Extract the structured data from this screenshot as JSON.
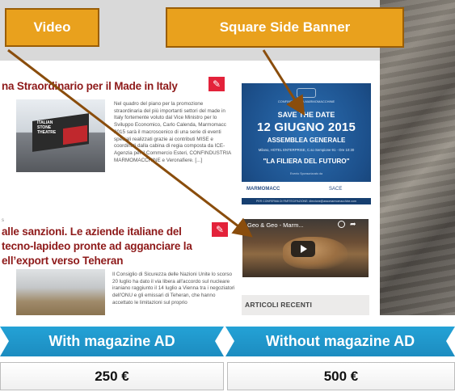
{
  "callouts": {
    "video": "Video",
    "banner": "Square Side Banner"
  },
  "posts": [
    {
      "title": "na Straordinario per il Made in Italy",
      "edit_icon": "edit-icon",
      "excerpt": "Nel quadro del piano per la promozione straordinaria del più importanti settori del made in Italy fortemente voluto dal Vice Ministro per lo Sviluppo Economico, Carlo Calenda, Marmomacc 2015 sarà il macroscenico di una serie di eventi speciali realizzati grazie ai contributi MISE e coordinati dalla cabina di regia composta da ICE-Agenzia per il Commercio Esteri, CONFINDUSTRIA MARMOMACCHINE e Veronafiere. [...]",
      "image_caption": [
        "ITALIAN",
        "STONE",
        "THEATRE"
      ],
      "footer": "s"
    },
    {
      "title": "alle sanzioni. Le aziende italiane del tecno-lapideo pronte ad agganciare la ell’export verso Teheran",
      "edit_icon": "edit-icon",
      "excerpt": "Il Consiglio di Sicurezza delle Nazioni Unite lo scorso 20 luglio ha dato il via libera all'accordo sul nucleare iraniano raggiunto il 14 luglio a Vienna tra i negoziatori dell'ONU e gli emissari di Teheran, che hanno accettato le limitazioni sul proprio"
    }
  ],
  "banner": {
    "org": "CONFINDUSTRIA MARMOMACCHINE",
    "save": "SAVE THE DATE",
    "date": "12 GIUGNO 2015",
    "assembly": "ASSEMBLEA GENERALE",
    "place": "Milano, HOTEL ENTERPRISE, C.so Sempione 91 - Ore 10:30",
    "slogan": "\"LA FILIERA DEL FUTURO\"",
    "evento": "Evento Sponsorizzato da",
    "sponsor1": "MARMOMACC",
    "sponsor2": "SACE",
    "info": "PER CONFERMA DI PARTECIPAZIONE: direzione@assomarmomacchine.com"
  },
  "video": {
    "title": "Geo & Geo - Marm...",
    "clock_icon": "clock-icon",
    "share_icon": "share-icon",
    "play_icon": "play-icon"
  },
  "sidebar": {
    "recent_title": "ARTICOLI RECENTI"
  },
  "pricing": {
    "headers": [
      "With magazine AD",
      "Without magazine AD"
    ],
    "prices": [
      "250 €",
      "500 €"
    ],
    "header_color": "#1f97cd"
  },
  "colors": {
    "callout": "#e9a11d",
    "arrow": "#8a4d0c",
    "title_red": "#8e1a1a",
    "edit_badge": "#e3223a"
  }
}
